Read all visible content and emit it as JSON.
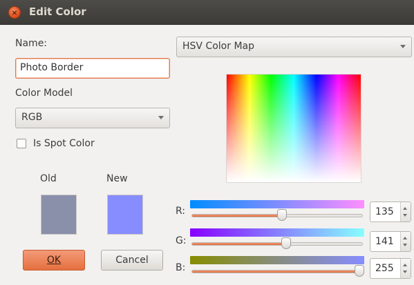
{
  "window": {
    "title": "Edit Color",
    "close_glyph": "×"
  },
  "name": {
    "label": "Name:",
    "value": "Photo Border"
  },
  "color_model": {
    "label": "Color Model",
    "selected": "RGB"
  },
  "spot_color": {
    "label": "Is Spot Color",
    "checked": false
  },
  "preview": {
    "old_label": "Old",
    "new_label": "New",
    "old_color": "#8a8faa",
    "new_color": "#878dff"
  },
  "buttons": {
    "ok": "OK",
    "cancel": "Cancel"
  },
  "color_map": {
    "selected": "HSV Color Map"
  },
  "channels": [
    {
      "label": "R:",
      "value": 135,
      "max": 255,
      "gradient_start": "#008dff",
      "gradient_end": "#ff8dff"
    },
    {
      "label": "G:",
      "value": 141,
      "max": 255,
      "gradient_start": "#8700ff",
      "gradient_end": "#87ffff"
    },
    {
      "label": "B:",
      "value": 255,
      "max": 255,
      "gradient_start": "#878d00",
      "gradient_end": "#878dff"
    }
  ],
  "icons": {
    "close": "close-icon",
    "dropdown": "chevron-down-icon",
    "spin_up": "spin-up-icon",
    "spin_down": "spin-down-icon"
  }
}
